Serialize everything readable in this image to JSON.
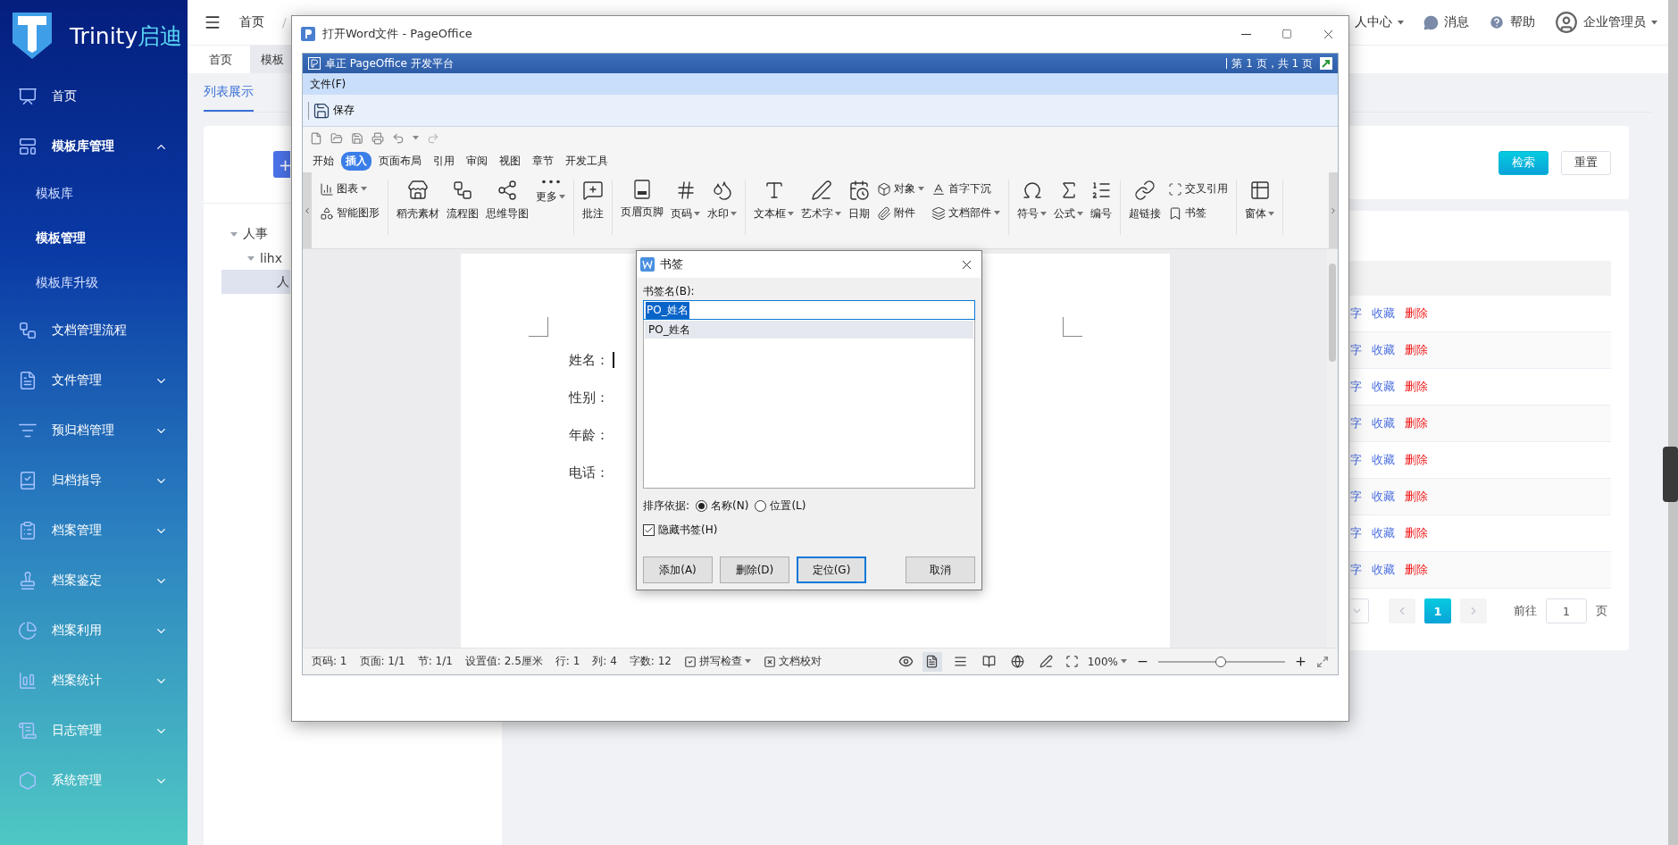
{
  "sidebar": {
    "logo": {
      "text": "Trinity",
      "accent": "启迪"
    },
    "items": [
      {
        "kind": "link",
        "label": "首页"
      },
      {
        "kind": "group",
        "label": "模板库管理",
        "expanded": true,
        "children": [
          {
            "label": "模板库",
            "selected": false
          },
          {
            "label": "模板管理",
            "selected": true
          },
          {
            "label": "模板库升级",
            "selected": false
          }
        ]
      },
      {
        "kind": "link",
        "label": "文档管理流程"
      },
      {
        "kind": "group",
        "label": "文件管理",
        "expanded": false
      },
      {
        "kind": "group",
        "label": "预归档管理",
        "expanded": false
      },
      {
        "kind": "group",
        "label": "归档指导",
        "expanded": false
      },
      {
        "kind": "group",
        "label": "档案管理",
        "expanded": false
      },
      {
        "kind": "group",
        "label": "档案鉴定",
        "expanded": false
      },
      {
        "kind": "group",
        "label": "档案利用",
        "expanded": false
      },
      {
        "kind": "group",
        "label": "档案统计",
        "expanded": false
      },
      {
        "kind": "group",
        "label": "日志管理",
        "expanded": false
      },
      {
        "kind": "group",
        "label": "系统管理",
        "expanded": false
      }
    ]
  },
  "header": {
    "breadcrumb": "首页",
    "separator": "/",
    "links": [
      {
        "kind": "menu",
        "label": "人中心"
      },
      {
        "kind": "messages",
        "label": "消息"
      },
      {
        "kind": "help",
        "label": "帮助"
      },
      {
        "kind": "user",
        "label": "企业管理员"
      }
    ]
  },
  "tabs": [
    {
      "label": "首页",
      "selected": false
    },
    {
      "label": "模板",
      "selected": true
    }
  ],
  "subtabs": [
    {
      "label": "列表展示",
      "selected": true
    }
  ],
  "tree_panel": {
    "add_button": "+",
    "tree": [
      {
        "label": "人事",
        "selected": false,
        "expanded": true,
        "children": [
          {
            "label": "lihx",
            "selected": false,
            "expanded": true,
            "children": [
              {
                "label": "人",
                "selected": true
              }
            ]
          }
        ]
      }
    ]
  },
  "search_card": {
    "buttons": [
      {
        "label": "检索",
        "kind": "primary"
      },
      {
        "label": "重置",
        "kind": "plain"
      }
    ]
  },
  "table": {
    "rows": [
      {
        "actions": [
          {
            "label": "字",
            "kind": "link"
          },
          {
            "label": "收藏",
            "kind": "link"
          },
          {
            "label": "删除",
            "kind": "danger"
          }
        ]
      },
      {
        "actions": [
          {
            "label": "字",
            "kind": "link"
          },
          {
            "label": "收藏",
            "kind": "link"
          },
          {
            "label": "删除",
            "kind": "danger"
          }
        ]
      },
      {
        "actions": [
          {
            "label": "字",
            "kind": "link"
          },
          {
            "label": "收藏",
            "kind": "link"
          },
          {
            "label": "删除",
            "kind": "danger"
          }
        ]
      },
      {
        "actions": [
          {
            "label": "字",
            "kind": "link"
          },
          {
            "label": "收藏",
            "kind": "link"
          },
          {
            "label": "删除",
            "kind": "danger"
          }
        ]
      },
      {
        "actions": [
          {
            "label": "字",
            "kind": "link"
          },
          {
            "label": "收藏",
            "kind": "link"
          },
          {
            "label": "删除",
            "kind": "danger"
          }
        ]
      },
      {
        "actions": [
          {
            "label": "字",
            "kind": "link"
          },
          {
            "label": "收藏",
            "kind": "link"
          },
          {
            "label": "删除",
            "kind": "danger"
          }
        ]
      },
      {
        "actions": [
          {
            "label": "字",
            "kind": "link"
          },
          {
            "label": "收藏",
            "kind": "link"
          },
          {
            "label": "删除",
            "kind": "danger"
          }
        ]
      },
      {
        "actions": [
          {
            "label": "字",
            "kind": "link"
          },
          {
            "label": "收藏",
            "kind": "link"
          },
          {
            "label": "删除",
            "kind": "danger"
          }
        ]
      }
    ]
  },
  "pagination": {
    "pages": [
      {
        "label": "1",
        "selected": true
      }
    ],
    "goto_label": "前往",
    "goto_value": "1",
    "page_suffix": "页"
  },
  "pageoffice": {
    "title": "打开Word文件 - PageOffice",
    "banner": "卓正 PageOffice 开发平台",
    "page_info": "第 1 页，共 1 页",
    "menu": [
      "文件(F)"
    ],
    "save": "保存",
    "ribbon_tabs": [
      {
        "label": "开始",
        "selected": false
      },
      {
        "label": "插入",
        "selected": true
      },
      {
        "label": "页面布局",
        "selected": false
      },
      {
        "label": "引用",
        "selected": false
      },
      {
        "label": "审阅",
        "selected": false
      },
      {
        "label": "视图",
        "selected": false
      },
      {
        "label": "章节",
        "selected": false
      },
      {
        "label": "开发工具",
        "selected": false
      }
    ],
    "ribbon_groups": [
      {
        "items": [
          {
            "kind": "small",
            "label": "图表",
            "dropdown": true
          },
          {
            "kind": "small",
            "label": "智能图形",
            "dropdown": false
          }
        ]
      },
      {
        "items": [
          {
            "kind": "large",
            "label": "稻壳素材",
            "dropdown": false
          },
          {
            "kind": "large",
            "label": "流程图",
            "dropdown": false
          },
          {
            "kind": "large",
            "label": "思维导图",
            "dropdown": false
          },
          {
            "kind": "large",
            "label": "更多",
            "dropdown": true
          }
        ]
      },
      {
        "items": [
          {
            "kind": "large",
            "label": "批注",
            "dropdown": false
          }
        ]
      },
      {
        "items": [
          {
            "kind": "large",
            "label": "页眉页脚",
            "dropdown": false
          },
          {
            "kind": "large",
            "label": "页码",
            "dropdown": true
          },
          {
            "kind": "large",
            "label": "水印",
            "dropdown": true
          }
        ]
      },
      {
        "items": [
          {
            "kind": "large",
            "label": "文本框",
            "dropdown": true
          },
          {
            "kind": "large",
            "label": "艺术字",
            "dropdown": true
          },
          {
            "kind": "large",
            "label": "日期",
            "dropdown": false
          },
          {
            "kind": "small",
            "label": "对象",
            "dropdown": true
          },
          {
            "kind": "small",
            "label": "附件",
            "dropdown": false
          },
          {
            "kind": "small",
            "label": "首字下沉",
            "dropdown": false
          },
          {
            "kind": "small",
            "label": "文档部件",
            "dropdown": true
          }
        ]
      },
      {
        "items": [
          {
            "kind": "large",
            "label": "符号",
            "dropdown": true
          },
          {
            "kind": "large",
            "label": "公式",
            "dropdown": true
          },
          {
            "kind": "large",
            "label": "编号",
            "dropdown": false
          }
        ]
      },
      {
        "items": [
          {
            "kind": "large",
            "label": "超链接",
            "dropdown": false
          },
          {
            "kind": "small",
            "label": "交叉引用",
            "dropdown": false
          },
          {
            "kind": "small",
            "label": "书签",
            "dropdown": false
          }
        ]
      },
      {
        "items": [
          {
            "kind": "large",
            "label": "窗体",
            "dropdown": true
          }
        ]
      }
    ],
    "document": {
      "lines": [
        "姓名：",
        "性别：",
        "年龄：",
        "电话："
      ]
    },
    "status": {
      "fields": [
        "页码: 1",
        "页面: 1/1",
        "节: 1/1",
        "设置值: 2.5厘米",
        "行: 1",
        "列: 4",
        "字数: 12"
      ],
      "spell_check": "拼写检查",
      "proofread": "文档校对",
      "views": [
        {
          "selected": true
        },
        {
          "selected": false
        },
        {
          "selected": false
        },
        {
          "selected": false
        },
        {
          "selected": false
        }
      ],
      "zoom": {
        "label": "100%",
        "level": 0.49
      }
    }
  },
  "dialog": {
    "title": "书签",
    "name_label": "书签名(B):",
    "name_value": "PO_姓名",
    "list": [
      {
        "label": "PO_姓名",
        "selected": true
      }
    ],
    "sort_label": "排序依据:",
    "sort_options": [
      {
        "label": "名称(N)",
        "selected": true
      },
      {
        "label": "位置(L)",
        "selected": false
      }
    ],
    "hide": {
      "label": "隐藏书签(H)",
      "checked": true
    },
    "buttons": [
      {
        "label": "添加(A)",
        "default": false
      },
      {
        "label": "删除(D)",
        "default": false
      },
      {
        "label": "定位(G)",
        "default": true
      },
      {
        "label": "取消",
        "default": false
      }
    ]
  }
}
